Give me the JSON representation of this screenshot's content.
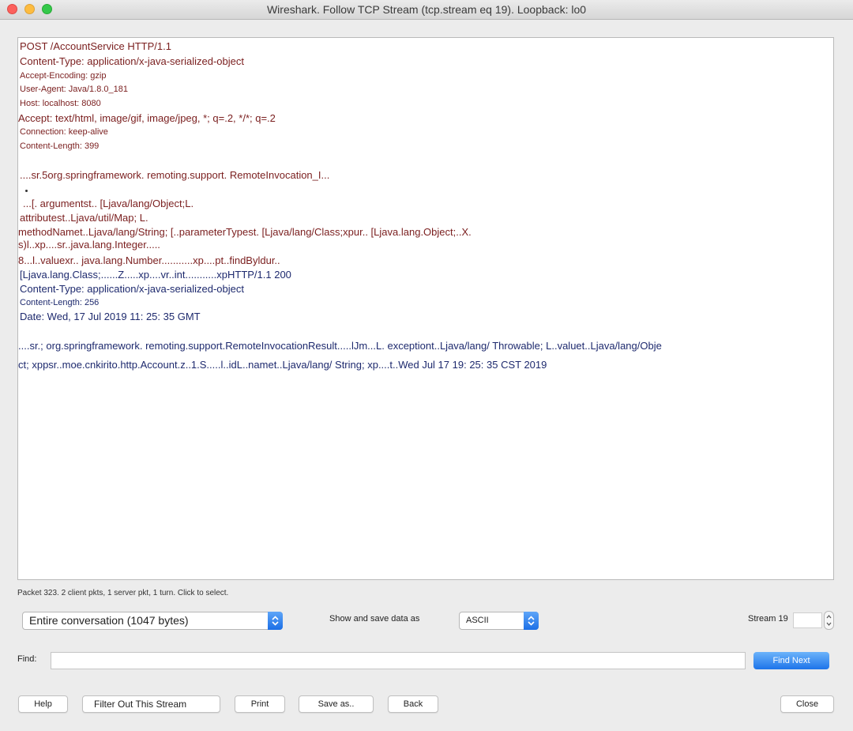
{
  "window": {
    "title": "Wireshark. Follow TCP Stream (tcp.stream eq 19). Loopback: lo0"
  },
  "stream": {
    "lines": [
      "POST /AccountService HTTP/1.1",
      "Content-Type: application/x-java-serialized-object",
      "Accept-Encoding: gzip",
      "User-Agent: Java/1.8.0_181",
      "Host: localhost: 8080",
      "Accept: text/html, image/gif, image/jpeg, *;  q=.2, */*;  q=.2",
      "Connection: keep-alive",
      "Content-Length: 399",
      "....sr.5org.springframework. remoting.support. RemoteInvocation_I...",
      "...[. argumentst.. [Ljava/lang/Object;L.",
      "attributest..Ljava/util/Map; L.",
      "methodNamet..Ljava/lang/String; [..parameterTypest. [Ljava/lang/Class;xpur.. [Ljava.lang.Object;..X.",
      "s)l..xp....sr..java.lang.Integer.....",
      "8...l..valuexr.. java.lang.Number...........xp....pt..findByldur..",
      "[Ljava.lang.Class;......Z.....xp....vr..int...........xpHTTP/1.1 200",
      "Content-Type: application/x-java-serialized-object",
      "Content-Length: 256",
      "Date: Wed, 17 Jul 2019 11: 25: 35 GMT",
      "....sr.; org.springframework. remoting.support.RemoteInvocationResult.....lJm...L. exceptiont..Ljava/lang/ Throwable; L..valuet..Ljava/lang/Obje",
      "ct; xppsr..moe.cnkirito.http.Account.z..1.S.....l..idL..namet..Ljava/lang/ String; xp....t..Wed Jul 17 19: 25: 35 CST 2019"
    ]
  },
  "status_text": "Packet 323. 2 client pkts, 1 server pkt, 1 turn. Click to select.",
  "conversation_select": {
    "value": "Entire conversation (1047 bytes)"
  },
  "show_save_label": "Show and save data as",
  "format_select": {
    "value": "ASCII"
  },
  "stream_label": "Stream 19",
  "find": {
    "label": "Find:",
    "value": "",
    "next_label": "Find Next"
  },
  "buttons": {
    "help": "Help",
    "filter_out": "Filter Out This Stream",
    "print": "Print",
    "save_as": "Save as..",
    "back": "Back",
    "close": "Close"
  }
}
